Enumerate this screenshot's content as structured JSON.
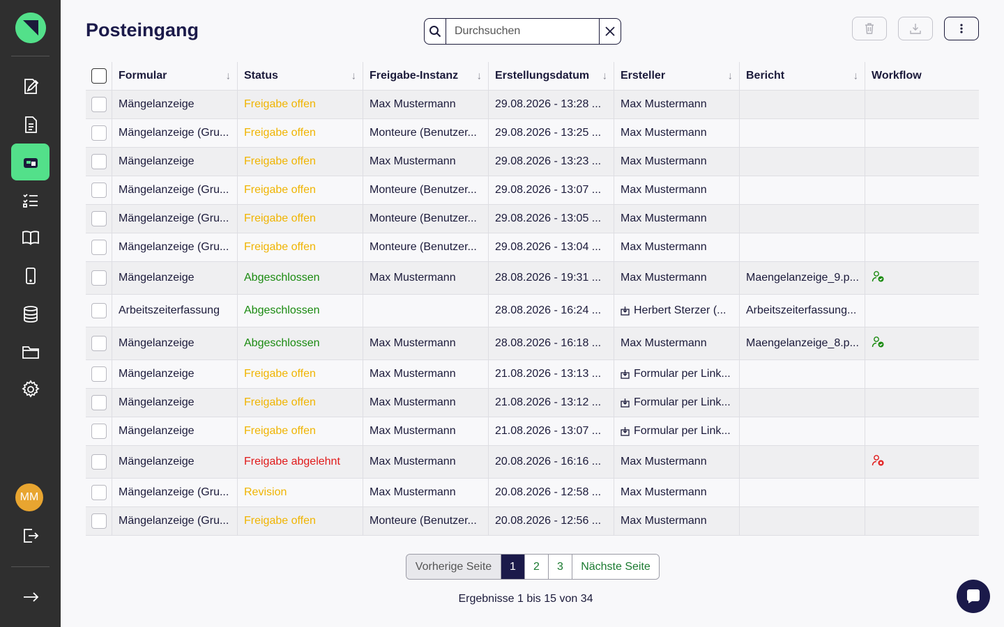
{
  "header": {
    "title": "Posteingang",
    "search_placeholder": "Durchsuchen",
    "search_value": ""
  },
  "sidebar": {
    "avatar_initials": "MM",
    "items": [
      {
        "name": "edit-form-icon"
      },
      {
        "name": "document-icon"
      },
      {
        "name": "inbox-icon",
        "active": true
      },
      {
        "name": "checklist-icon"
      },
      {
        "name": "book-icon"
      },
      {
        "name": "mobile-icon"
      },
      {
        "name": "database-icon"
      },
      {
        "name": "folder-icon"
      },
      {
        "name": "gear-icon"
      }
    ]
  },
  "table": {
    "columns": [
      "Formular",
      "Status",
      "Freigabe-Instanz",
      "Erstellungsdatum",
      "Ersteller",
      "Bericht",
      "Workflow"
    ],
    "rows": [
      {
        "formular": "Mängelanzeige",
        "status": "Freigabe offen",
        "status_type": "open",
        "instanz": "Max Mustermann",
        "datum": "29.08.2026 - 13:28 ...",
        "ersteller": "Max Mustermann",
        "link": false,
        "bericht": "",
        "workflow": ""
      },
      {
        "formular": "Mängelanzeige (Gru...",
        "status": "Freigabe offen",
        "status_type": "open",
        "instanz": "Monteure (Benutzer...",
        "datum": "29.08.2026 - 13:25 ...",
        "ersteller": "Max Mustermann",
        "link": false,
        "bericht": "",
        "workflow": ""
      },
      {
        "formular": "Mängelanzeige",
        "status": "Freigabe offen",
        "status_type": "open",
        "instanz": "Max Mustermann",
        "datum": "29.08.2026 - 13:23 ...",
        "ersteller": "Max Mustermann",
        "link": false,
        "bericht": "",
        "workflow": ""
      },
      {
        "formular": "Mängelanzeige (Gru...",
        "status": "Freigabe offen",
        "status_type": "open",
        "instanz": "Monteure (Benutzer...",
        "datum": "29.08.2026 - 13:07 ...",
        "ersteller": "Max Mustermann",
        "link": false,
        "bericht": "",
        "workflow": ""
      },
      {
        "formular": "Mängelanzeige (Gru...",
        "status": "Freigabe offen",
        "status_type": "open",
        "instanz": "Monteure (Benutzer...",
        "datum": "29.08.2026 - 13:05 ...",
        "ersteller": "Max Mustermann",
        "link": false,
        "bericht": "",
        "workflow": ""
      },
      {
        "formular": "Mängelanzeige (Gru...",
        "status": "Freigabe offen",
        "status_type": "open",
        "instanz": "Monteure (Benutzer...",
        "datum": "29.08.2026 - 13:04 ...",
        "ersteller": "Max Mustermann",
        "link": false,
        "bericht": "",
        "workflow": ""
      },
      {
        "formular": "Mängelanzeige",
        "status": "Abgeschlossen",
        "status_type": "done",
        "instanz": "Max Mustermann",
        "datum": "28.08.2026 - 19:31 ...",
        "ersteller": "Max Mustermann",
        "link": false,
        "bericht": "Maengelanzeige_9.p...",
        "workflow": "approved"
      },
      {
        "formular": "Arbeitszeiterfassung",
        "status": "Abgeschlossen",
        "status_type": "done",
        "instanz": "",
        "datum": "28.08.2026 - 16:24 ...",
        "ersteller": "Herbert Sterzer (...",
        "link": true,
        "bericht": "Arbeitszeiterfassung...",
        "workflow": ""
      },
      {
        "formular": "Mängelanzeige",
        "status": "Abgeschlossen",
        "status_type": "done",
        "instanz": "Max Mustermann",
        "datum": "28.08.2026 - 16:18 ...",
        "ersteller": "Max Mustermann",
        "link": false,
        "bericht": "Maengelanzeige_8.p...",
        "workflow": "approved"
      },
      {
        "formular": "Mängelanzeige",
        "status": "Freigabe offen",
        "status_type": "open",
        "instanz": "Max Mustermann",
        "datum": "21.08.2026 - 13:13 ...",
        "ersteller": "Formular per Link...",
        "link": true,
        "bericht": "",
        "workflow": ""
      },
      {
        "formular": "Mängelanzeige",
        "status": "Freigabe offen",
        "status_type": "open",
        "instanz": "Max Mustermann",
        "datum": "21.08.2026 - 13:12 ...",
        "ersteller": "Formular per Link...",
        "link": true,
        "bericht": "",
        "workflow": ""
      },
      {
        "formular": "Mängelanzeige",
        "status": "Freigabe offen",
        "status_type": "open",
        "instanz": "Max Mustermann",
        "datum": "21.08.2026 - 13:07 ...",
        "ersteller": "Formular per Link...",
        "link": true,
        "bericht": "",
        "workflow": ""
      },
      {
        "formular": "Mängelanzeige",
        "status": "Freigabe abgelehnt",
        "status_type": "rejected",
        "instanz": "Max Mustermann",
        "datum": "20.08.2026 - 16:16 ...",
        "ersteller": "Max Mustermann",
        "link": false,
        "bericht": "",
        "workflow": "rejected"
      },
      {
        "formular": "Mängelanzeige (Gru...",
        "status": "Revision",
        "status_type": "revision",
        "instanz": "Max Mustermann",
        "datum": "20.08.2026 - 12:58 ...",
        "ersteller": "Max Mustermann",
        "link": false,
        "bericht": "",
        "workflow": ""
      },
      {
        "formular": "Mängelanzeige (Gru...",
        "status": "Freigabe offen",
        "status_type": "open",
        "instanz": "Monteure (Benutzer...",
        "datum": "20.08.2026 - 12:56 ...",
        "ersteller": "Max Mustermann",
        "link": false,
        "bericht": "",
        "workflow": ""
      }
    ]
  },
  "pagination": {
    "prev_label": "Vorherige Seite",
    "pages": [
      "1",
      "2",
      "3"
    ],
    "current": "1",
    "next_label": "Nächste Seite",
    "results_text": "Ergebnisse 1 bis 15 von 34"
  },
  "colors": {
    "brand": "#53e08a",
    "sidebar": "#2f2f2f",
    "status_open": "#f0b400",
    "status_done": "#1a8a10",
    "status_rejected": "#e01a1a",
    "primary_dark": "#1b1a4a"
  }
}
